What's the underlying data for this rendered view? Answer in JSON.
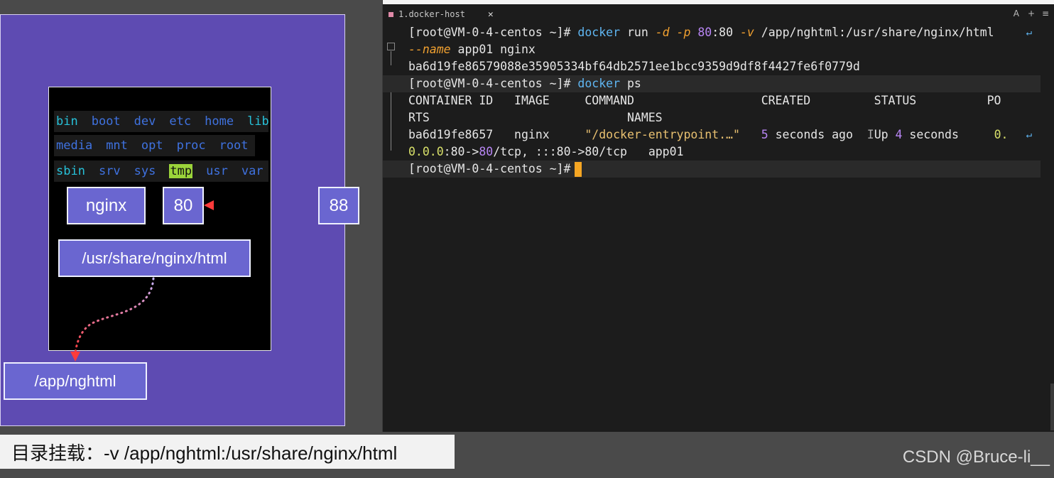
{
  "diagram": {
    "dirs_row1": [
      "bin",
      "boot",
      "dev",
      "etc",
      "home",
      "lib"
    ],
    "dirs_row2": [
      "media",
      "mnt",
      "opt",
      "proc",
      "root"
    ],
    "dirs_row3": [
      "sbin",
      "srv",
      "sys",
      "tmp",
      "usr",
      "var"
    ],
    "container_name": "nginx",
    "container_port": "80",
    "host_port": "88",
    "container_path": "/usr/share/nginx/html",
    "host_path": "/app/nghtml"
  },
  "caption": "目录挂载：-v /app/nghtml:/usr/share/nginx/html",
  "watermark": "CSDN @Bruce-li__",
  "terminal": {
    "tab_title": "1.docker-host",
    "tab_close": "✕",
    "ctl_a": "A",
    "ctl_plus": "+",
    "ctl_menu": "≡",
    "prompt": "[root@VM-0-4-centos ~]#",
    "cmd1": {
      "docker": "docker",
      "run": "run",
      "flag_d": "-d",
      "flag_p": "-p",
      "port_a": "80",
      "colon": ":",
      "port_b": "80",
      "flag_v": "-v",
      "volume": "/app/nghtml:/usr/share/nginx/html",
      "flag_name": "--name",
      "name_rest": "app01 nginx"
    },
    "container_hash": "ba6d19fe86579088e35905334bf64db2571ee1bcc9359d9df8f4427fe6f0779d",
    "cmd2": {
      "docker": "docker",
      "ps": "ps"
    },
    "ps_header1": "CONTAINER ID   IMAGE     COMMAND                  CREATED         STATUS          PO",
    "ps_header2": "RTS                            NAMES",
    "ps_row": {
      "id": "ba6d19fe8657",
      "image": "nginx",
      "command": "\"/docker-entrypoint.…\"",
      "created_num": "5",
      "created_rest": " seconds ago",
      "status_a": "Up ",
      "status_num": "4",
      "status_rest": " seconds",
      "ports_start": "0.",
      "ports_cont_a": "0.0.0",
      "ports_cont_b": ":80->",
      "ports_cont_c": "80",
      "ports_cont_d": "/tcp, ",
      "ports_cont_e": ":::80->",
      "ports_cont_f": "80",
      "ports_cont_g": "/tcp",
      "name": "app01"
    }
  }
}
